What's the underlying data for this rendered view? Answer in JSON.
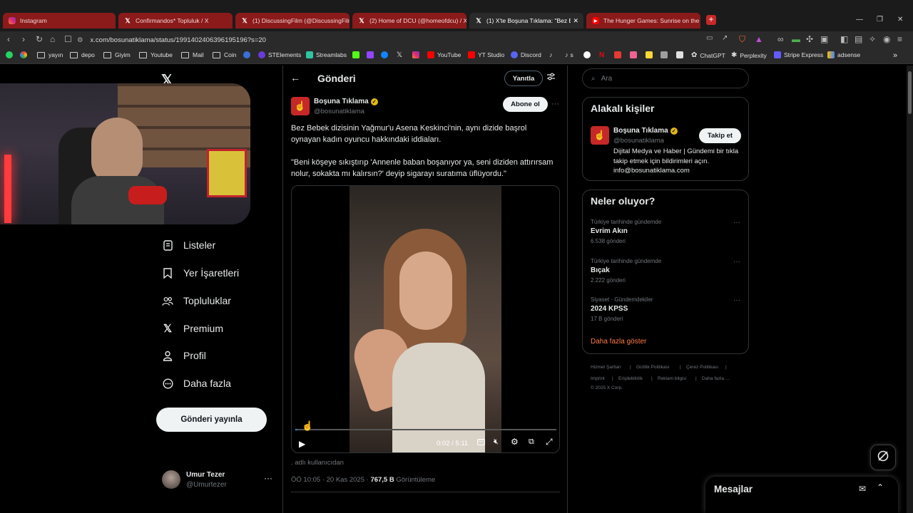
{
  "browser": {
    "tabs": [
      {
        "label": "Instagram",
        "icon": "instagram-icon"
      },
      {
        "label": "Confirmandos* Topluluk / X",
        "icon": "x-logo-icon"
      },
      {
        "label": "(1) DiscussingFilm (@DiscussingFilm",
        "icon": "x-logo-icon"
      },
      {
        "label": "(2) Home of DCU (@homeofdcu) / X",
        "icon": "x-logo-icon"
      },
      {
        "label": "(1) X'te Boşuna Tıklama: \"Bez Bel",
        "icon": "x-logo-icon",
        "active": true
      },
      {
        "label": "The Hunger Games: Sunrise on the R",
        "icon": "youtube-icon"
      }
    ],
    "url": "x.com/bosunatiklama/status/1991402406396195196?s=20",
    "bookmarks": [
      "yayın",
      "depo",
      "Giyim",
      "Youtube",
      "Mail",
      "Coin",
      "STElements",
      "Streamlabs",
      "YouTube",
      "YT Studio",
      "Discord",
      "s",
      "ChatGPT",
      "Perplexity",
      "Stripe Express",
      "adsense"
    ]
  },
  "nav": {
    "items": [
      {
        "label": "Listeler",
        "icon": "list-icon"
      },
      {
        "label": "Yer İşaretleri",
        "icon": "bookmark-icon"
      },
      {
        "label": "Topluluklar",
        "icon": "communities-icon"
      },
      {
        "label": "Premium",
        "icon": "x-premium-icon"
      },
      {
        "label": "Profil",
        "icon": "profile-icon"
      },
      {
        "label": "Daha fazla",
        "icon": "more-circle-icon"
      }
    ],
    "post_button": "Gönderi yayınla",
    "account": {
      "name": "Umur Tezer",
      "handle": "@Umurtezer"
    }
  },
  "post": {
    "header_title": "Gönderi",
    "reply_button": "Yanıtla",
    "author": {
      "name": "Boşuna Tıklama",
      "handle": "@bosunatiklama"
    },
    "subscribe_button": "Abone ol",
    "text_1": "Bez Bebek dizisinin Yağmur'u Asena Keskinci'nin, aynı dizide başrol oynayan kadın oyuncu hakkındaki iddiaları.",
    "text_2": "\"Beni köşeye sıkıştırıp 'Annenle baban boşanıyor ya, seni diziden attırırsam nolur, sokakta mı kalırsın?' deyip sigarayı suratıma üflüyordu.\"",
    "video": {
      "time": "0:02 / 5:11",
      "progress": 0.006
    },
    "source": ". adlı kullanıcıdan",
    "timestamp": "ÖÖ 10:05 · 20 Kas 2025 ·",
    "views_count": "767,5 B",
    "views_label": "Görüntüleme"
  },
  "right": {
    "search_placeholder": "Ara",
    "relevant_title": "Alakalı kişiler",
    "relevant_person": {
      "name": "Boşuna Tıklama",
      "handle": "@bosunatiklama",
      "bio": "Dijital Medya ve Haber | Gündemi bir tıkla takip etmek için bildirimleri açın. info@bosunatiklama.com",
      "follow_button": "Takip et"
    },
    "trends_title": "Neler oluyor?",
    "trends": [
      {
        "category": "Türkiye tarihinde gündemde",
        "name": "Evrim Akın",
        "count": "6.538 gönderi"
      },
      {
        "category": "Türkiye tarihinde gündemde",
        "name": "Bıçak",
        "count": "2.222 gönderi"
      },
      {
        "category": "Siyaset · Gündemdekiler",
        "name": "2024 KPSS",
        "count": "17 B gönderi"
      }
    ],
    "show_more": "Daha fazla göster",
    "footer": {
      "links_row1": [
        "Hizmet Şartları",
        "Gizlilik Politikası",
        "Çerez Politikası"
      ],
      "links_row2": [
        "Imprint",
        "Erişilebilirlik",
        "Reklam bilgisi",
        "Daha fazla ..."
      ],
      "copyright": "© 2025 X Corp."
    },
    "messages_title": "Mesajlar"
  },
  "colors": {
    "accent_red": "#c62828",
    "link_orange": "#ff7a45",
    "verified_gold": "#e2b719",
    "x_bg": "#000000"
  }
}
